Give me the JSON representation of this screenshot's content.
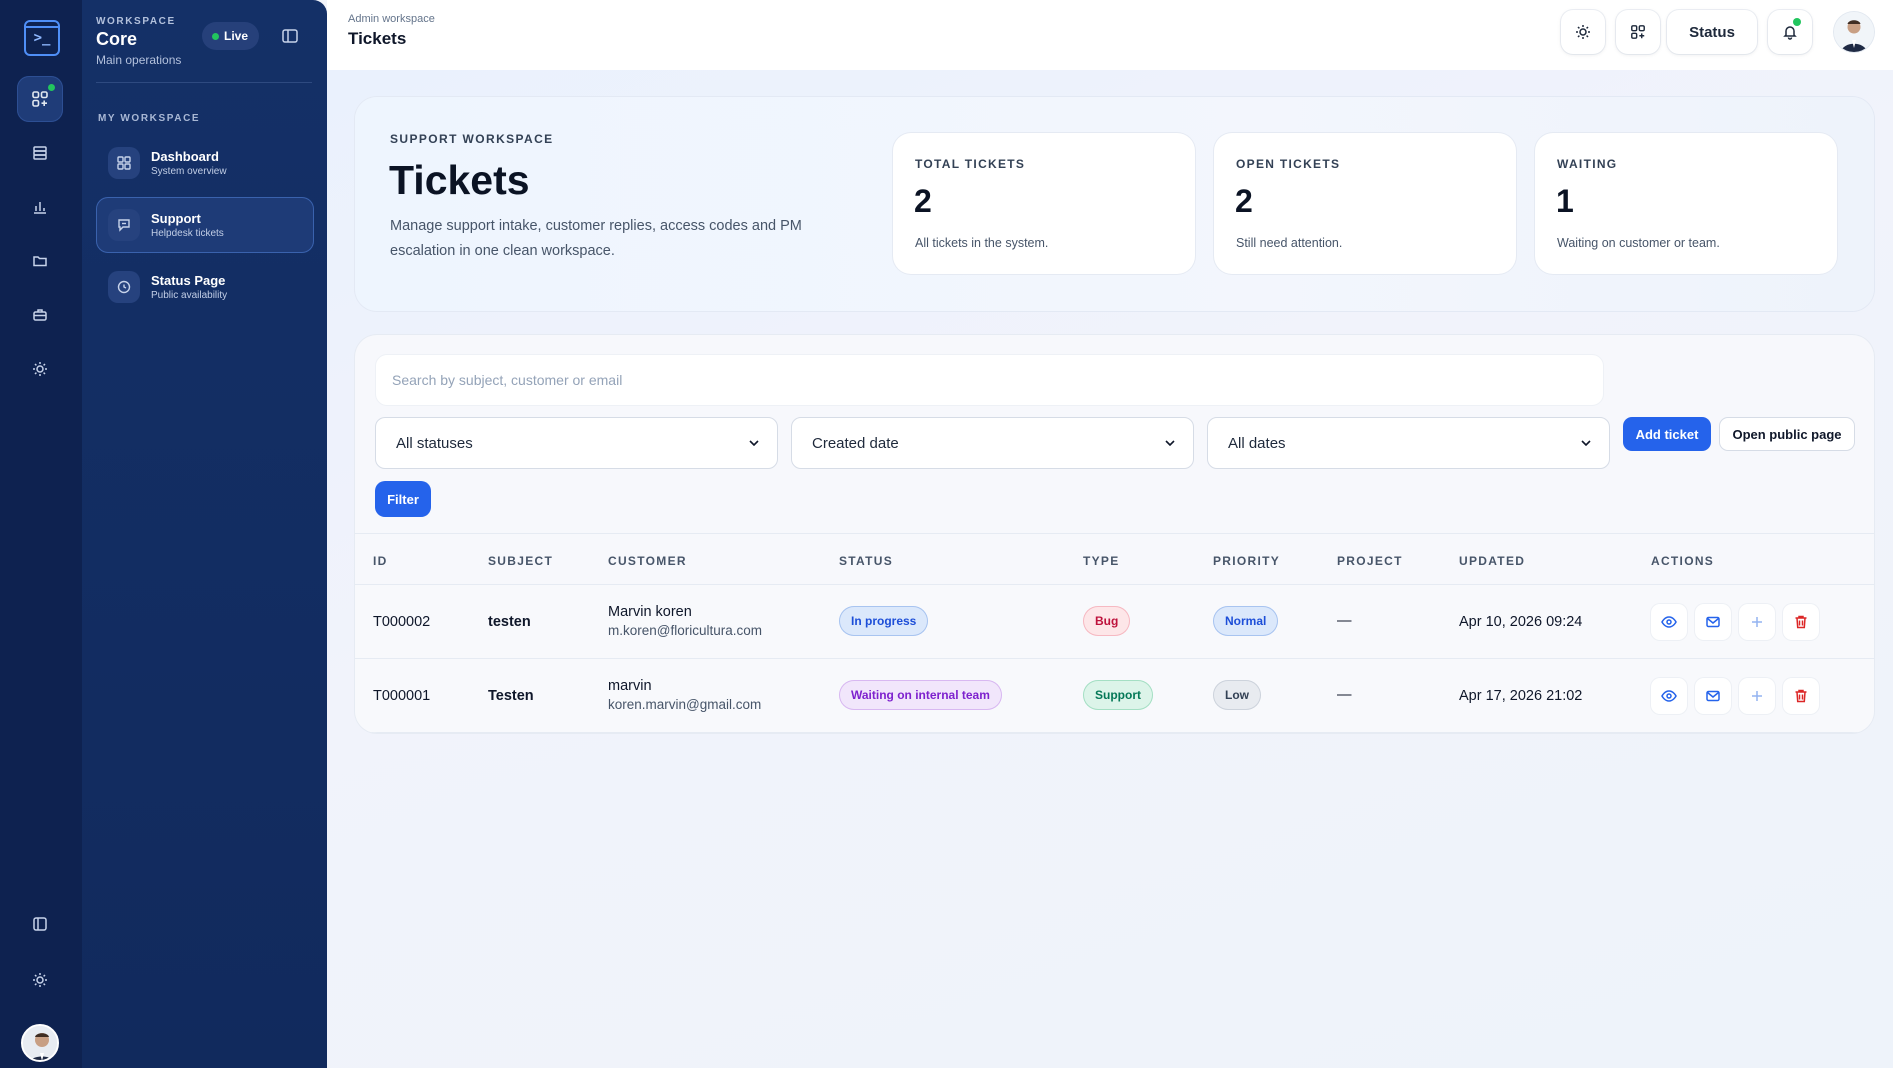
{
  "sidebar": {
    "workspace_label": "WORKSPACE",
    "workspace_name": "Core",
    "workspace_sub": "Main operations",
    "live_label": "Live",
    "section_label": "MY WORKSPACE",
    "items": [
      {
        "title": "Dashboard",
        "sub": "System overview",
        "icon": "grid-icon"
      },
      {
        "title": "Support",
        "sub": "Helpdesk tickets",
        "icon": "chat-icon",
        "active": true
      },
      {
        "title": "Status Page",
        "sub": "Public availability",
        "icon": "status-icon"
      }
    ]
  },
  "rail": {
    "icons": [
      "apps-icon",
      "server-icon",
      "chart-icon",
      "folder-icon",
      "briefcase-icon",
      "sun-icon",
      "sidebar-toggle-icon",
      "sun-icon"
    ]
  },
  "topbar": {
    "breadcrumb": "Admin workspace",
    "title": "Tickets",
    "status_label": "Status"
  },
  "hero": {
    "eyebrow": "SUPPORT WORKSPACE",
    "title": "Tickets",
    "description": "Manage support intake, customer replies, access codes and PM escalation in one clean workspace.",
    "stats": [
      {
        "label": "TOTAL TICKETS",
        "value": "2",
        "note": "All tickets in the system."
      },
      {
        "label": "OPEN TICKETS",
        "value": "2",
        "note": "Still need attention."
      },
      {
        "label": "WAITING",
        "value": "1",
        "note": "Waiting on customer or team."
      }
    ]
  },
  "filters": {
    "search_placeholder": "Search by subject, customer or email",
    "status_select": "All statuses",
    "sort_select": "Created date",
    "date_select": "All dates",
    "add_ticket": "Add ticket",
    "open_public": "Open public page",
    "filter": "Filter"
  },
  "table": {
    "headers": [
      "ID",
      "SUBJECT",
      "CUSTOMER",
      "STATUS",
      "TYPE",
      "PRIORITY",
      "PROJECT",
      "UPDATED",
      "ACTIONS"
    ],
    "rows": [
      {
        "id": "T000002",
        "subject": "testen",
        "name": "Marvin koren",
        "email": "m.koren@floricultura.com",
        "status": "In progress",
        "type": "Bug",
        "priority": "Normal",
        "project": "—",
        "updated": "Apr 10, 2026 09:24"
      },
      {
        "id": "T000001",
        "subject": "Testen",
        "name": "marvin",
        "email": "koren.marvin@gmail.com",
        "status": "Waiting on internal team",
        "type": "Support",
        "priority": "Low",
        "project": "—",
        "updated": "Apr 17, 2026 21:02"
      }
    ]
  },
  "colors": {
    "accent": "#2563eb",
    "sidebar": "#143067",
    "rail": "#0e2250",
    "live_dot": "#22c55e"
  }
}
